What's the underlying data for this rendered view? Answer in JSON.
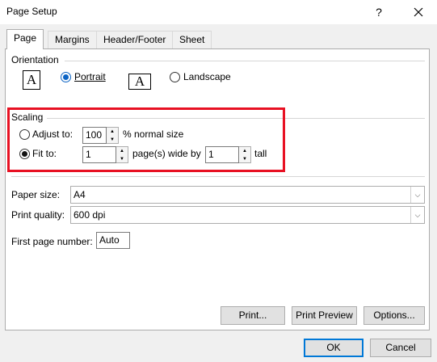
{
  "window": {
    "title": "Page Setup",
    "help": "?"
  },
  "tabs": [
    {
      "label": "Page",
      "active": true
    },
    {
      "label": "Margins"
    },
    {
      "label": "Header/Footer"
    },
    {
      "label": "Sheet"
    }
  ],
  "orientation": {
    "group_label": "Orientation",
    "portrait_label": "Portrait",
    "landscape_label": "Landscape",
    "icon_glyph": "A",
    "selected": "portrait"
  },
  "scaling": {
    "group_label": "Scaling",
    "adjust_label": "Adjust to:",
    "adjust_value": "100",
    "adjust_suffix": "% normal size",
    "fit_label": "Fit to:",
    "fit_wide_value": "1",
    "fit_wide_suffix": "page(s) wide by",
    "fit_tall_value": "1",
    "fit_tall_suffix": "tall",
    "selected": "fit"
  },
  "paper_size": {
    "label": "Paper size:",
    "value": "A4"
  },
  "print_quality": {
    "label": "Print quality:",
    "value": "600 dpi"
  },
  "first_page_number": {
    "label": "First page number:",
    "value": "Auto"
  },
  "buttons": {
    "print": "Print...",
    "print_preview": "Print Preview",
    "options": "Options...",
    "ok": "OK",
    "cancel": "Cancel"
  },
  "colors": {
    "highlight": "#e81123",
    "accent": "#0078d7"
  }
}
